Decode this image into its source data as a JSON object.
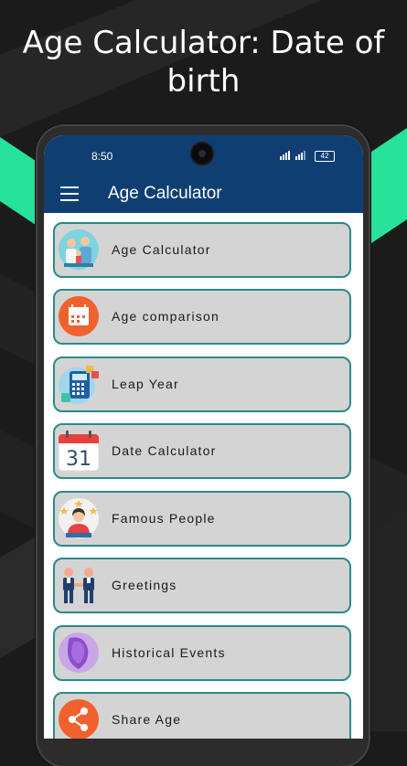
{
  "promo": {
    "title": "Age Calculator: Date of birth"
  },
  "statusbar": {
    "time": "8:50",
    "battery": "42"
  },
  "appbar": {
    "title": "Age Calculator"
  },
  "menu": [
    {
      "label": "Age Calculator",
      "icon": "family-icon"
    },
    {
      "label": "Age comparison",
      "icon": "calendar-icon"
    },
    {
      "label": "Leap Year",
      "icon": "calculator-icon"
    },
    {
      "label": "Date Calculator",
      "icon": "calendar-31-icon",
      "day": "31"
    },
    {
      "label": "Famous People",
      "icon": "famous-person-icon"
    },
    {
      "label": "Greetings",
      "icon": "greeting-people-icon"
    },
    {
      "label": "Historical Events",
      "icon": "historical-events-icon"
    },
    {
      "label": "Share Age",
      "icon": "share-icon"
    }
  ]
}
